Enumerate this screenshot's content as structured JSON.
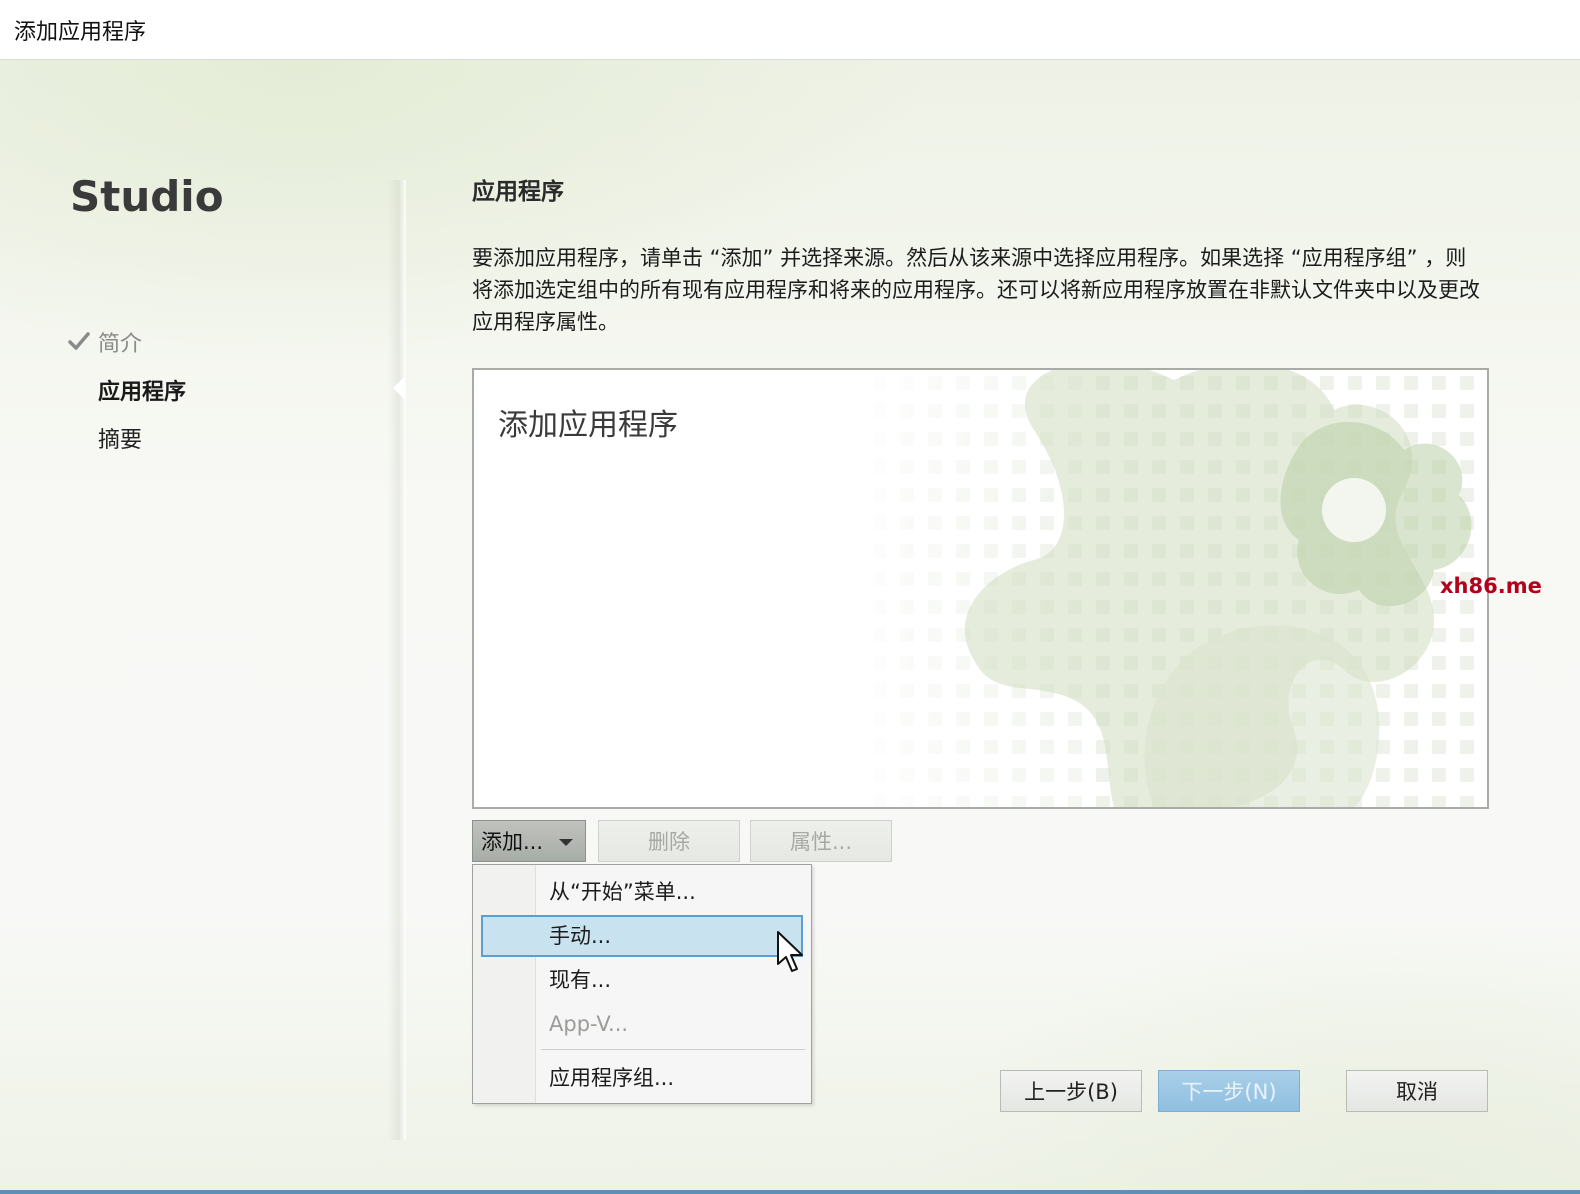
{
  "window": {
    "title": "添加应用程序"
  },
  "nav": {
    "brand": "Studio",
    "items": [
      {
        "label": "简介",
        "state": "done"
      },
      {
        "label": "应用程序",
        "state": "active"
      },
      {
        "label": "摘要",
        "state": "pending"
      }
    ]
  },
  "main": {
    "section_title": "应用程序",
    "description": "要添加应用程序，请单击 “添加” 并选择来源。然后从该来源中选择应用程序。如果选择 “应用程序组” ，则将添加选定组中的所有现有应用程序和将来的应用程序。还可以将新应用程序放置在非默认文件夹中以及更改应用程序属性。",
    "panel_title": "添加应用程序"
  },
  "toolbar": {
    "add_label": "添加...",
    "delete_label": "删除",
    "properties_label": "属性..."
  },
  "add_menu": {
    "items": [
      {
        "label": "从“开始”菜单...",
        "state": "normal"
      },
      {
        "label": "手动...",
        "state": "hover"
      },
      {
        "label": "现有...",
        "state": "normal"
      },
      {
        "label": "App-V...",
        "state": "disabled"
      },
      {
        "label": "应用程序组...",
        "state": "normal"
      }
    ]
  },
  "footer": {
    "back_label": "上一步(B)",
    "next_label": "下一步(N)",
    "cancel_label": "取消"
  },
  "watermark": "xh86.me",
  "colors": {
    "accent": "#5b9fd0",
    "menu_hover": "#c9e2ef",
    "next_button": "#9ac6e4",
    "art_green": "#c9d8b8",
    "watermark": "#b3001b"
  }
}
